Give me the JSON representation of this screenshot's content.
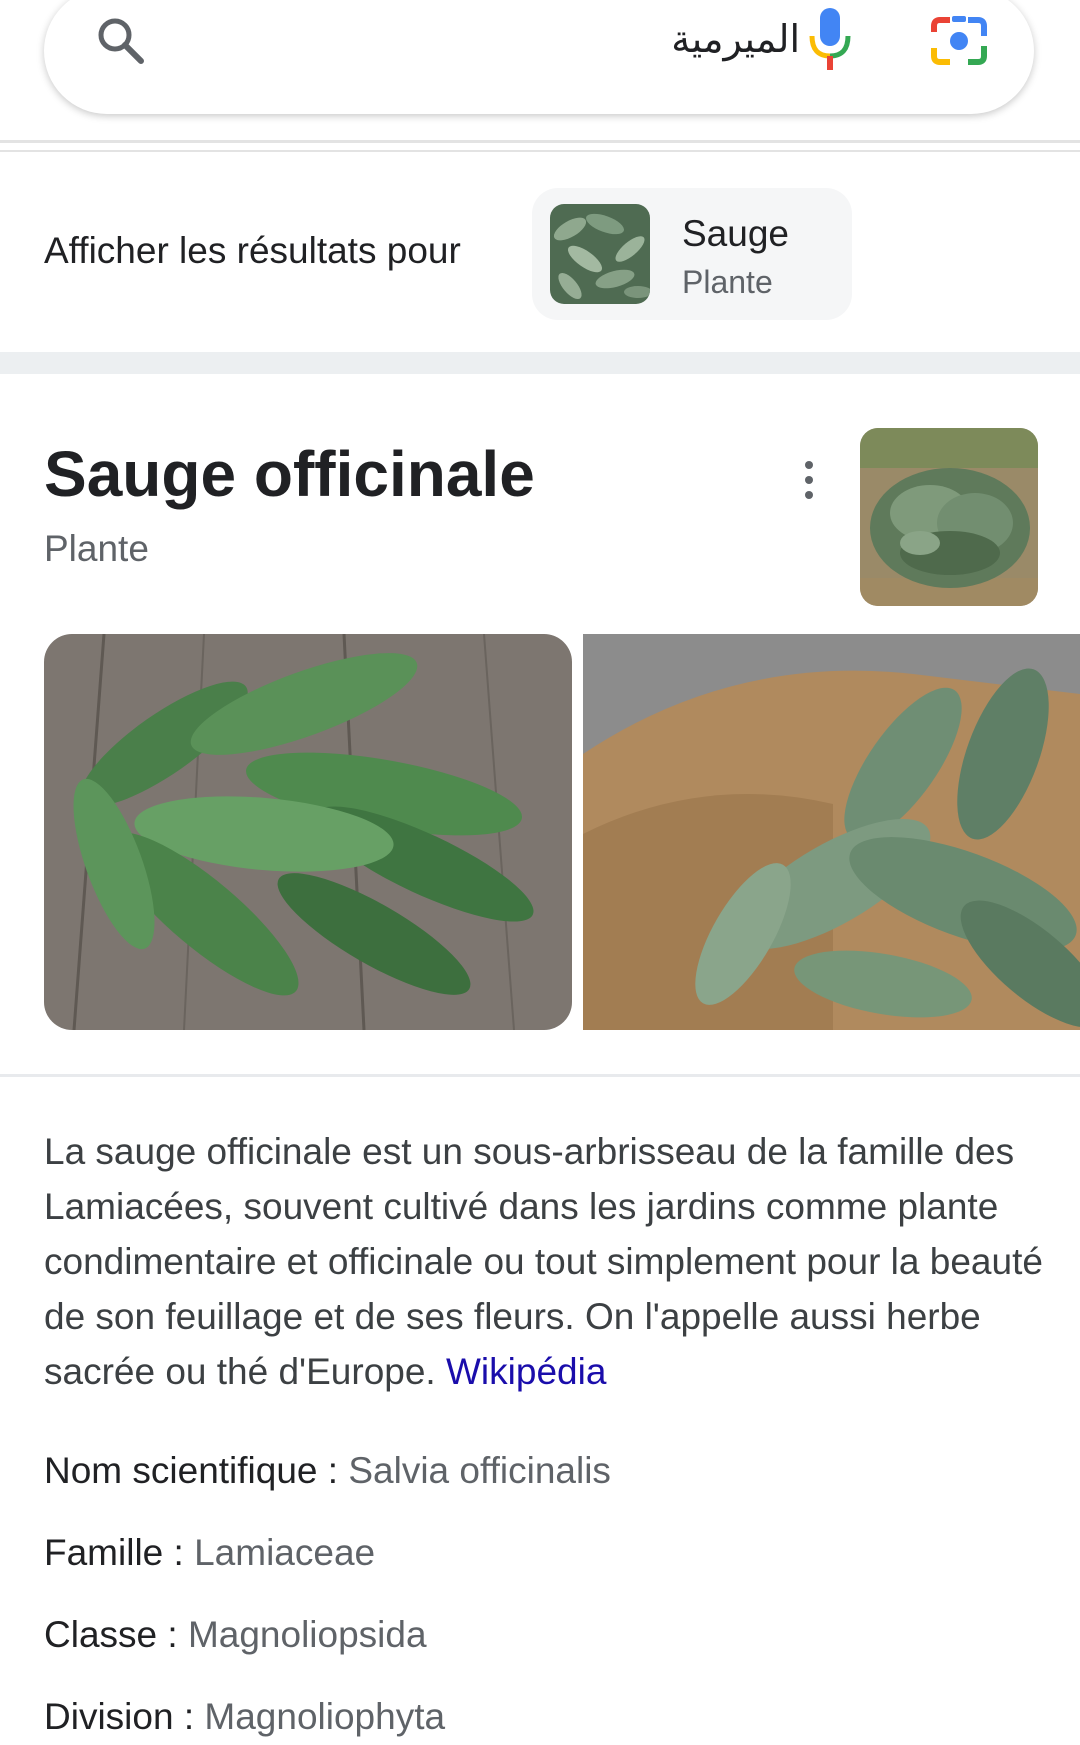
{
  "search": {
    "query": "الميرمية"
  },
  "results_for": {
    "label": "Afficher les résultats pour",
    "chip_title": "Sauge",
    "chip_subtitle": "Plante"
  },
  "knowledge_panel": {
    "title": "Sauge officinale",
    "subtitle": "Plante",
    "description": "La sauge officinale est un sous-arbrisseau de la famille des Lamiacées, souvent cultivé dans les jardins comme plante condimentaire et officinale ou tout simplement pour la beauté de son feuillage et de ses fleurs. On l'appelle aussi herbe sacrée ou thé d'Europe.",
    "source_link": "Wikipédia",
    "facts": [
      {
        "label": "Nom scientifique",
        "sep": " : ",
        "value": "Salvia officinalis"
      },
      {
        "label": "Famille",
        "sep": " : ",
        "value": "Lamiaceae"
      },
      {
        "label": "Classe",
        "sep": " : ",
        "value": "Magnoliopsida"
      },
      {
        "label": "Division",
        "sep": " : ",
        "value": "Magnoliophyta"
      }
    ]
  },
  "icons": {
    "search": "search-icon",
    "mic": "mic-icon",
    "camera": "google-lens-icon",
    "more": "more-vert-icon"
  },
  "colors": {
    "link": "#1a0dab",
    "text": "#202124",
    "secondary_text": "#5f6368",
    "mic_blue": "#4285f4",
    "mic_red": "#ea4335",
    "mic_yellow": "#fbbc04",
    "mic_green": "#34a853"
  }
}
